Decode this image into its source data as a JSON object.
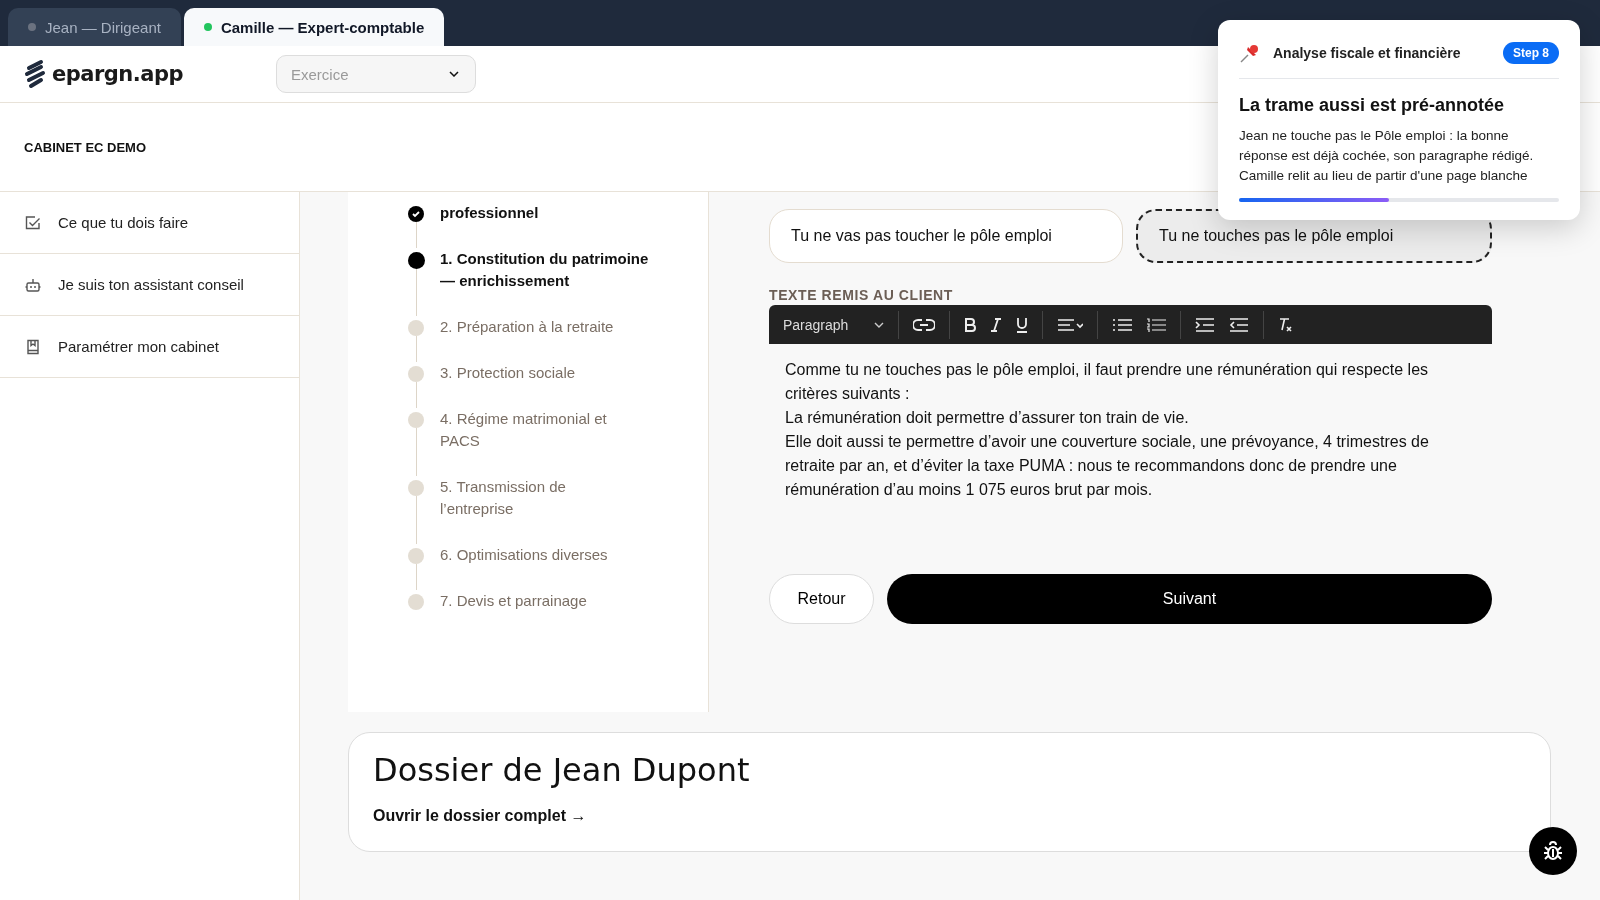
{
  "tabs": [
    {
      "label": "Jean — Dirigeant",
      "selected": false,
      "color": "#6b7280"
    },
    {
      "label": "Camille — Expert-comptable",
      "selected": true,
      "color": "#22c55e"
    }
  ],
  "header": {
    "logo": "epargn.app",
    "select": {
      "placeholder": "Exercice"
    }
  },
  "cabinet": "CABINET EC DEMO",
  "sidebar": {
    "items": [
      {
        "label": "Ce que tu dois faire"
      },
      {
        "label": "Je suis ton assistant conseil"
      },
      {
        "label": "Paramétrer mon cabinet"
      }
    ]
  },
  "steps": [
    {
      "label": "professionnel",
      "done": true,
      "current": false
    },
    {
      "label": "1. Constitution du patrimoine — enrichissement",
      "done": false,
      "current": true
    },
    {
      "label": "2. Préparation à la retraite",
      "done": false,
      "current": false
    },
    {
      "label": "3. Protection sociale",
      "done": false,
      "current": false
    },
    {
      "label": "4. Régime matrimonial et PACS",
      "done": false,
      "current": false
    },
    {
      "label": "5. Transmission de l’entreprise",
      "done": false,
      "current": false
    },
    {
      "label": "6. Optimisations diverses",
      "done": false,
      "current": false
    },
    {
      "label": "7. Devis et parrainage",
      "done": false,
      "current": false
    }
  ],
  "choices": [
    {
      "label": "Tu ne vas pas toucher le pôle emploi",
      "selected": false
    },
    {
      "label": "Tu ne touches pas le pôle emploi",
      "selected": true
    }
  ],
  "editor": {
    "label": "TEXTE REMIS AU CLIENT",
    "format": "Paragraph",
    "lines": [
      "Comme tu ne touches pas le pôle emploi, il faut prendre une rémunération qui respecte les critères suivants :",
      "La rémunération doit permettre d’assurer ton train de vie.",
      "Elle doit aussi te permettre d’avoir une couverture sociale, une prévoyance, 4 trimestres de retraite par an, et d’éviter la taxe PUMA : nous te recommandons donc de prendre une rémunération d’au moins 1 075 euros brut par mois."
    ]
  },
  "buttons": {
    "back": "Retour",
    "next": "Suivant"
  },
  "dossier": {
    "title": "Dossier de Jean Dupont",
    "link": "Ouvrir le dossier complet →"
  },
  "popover": {
    "section": "Analyse fiscale et financière",
    "badge": "Step 8",
    "title": "La trame aussi est pré-annotée",
    "text": "Jean ne touche pas le Pôle emploi : la bonne réponse est déjà cochée, son paragraphe rédigé. Camille relit au lieu de partir d'une page blanche",
    "level": 0.47
  }
}
